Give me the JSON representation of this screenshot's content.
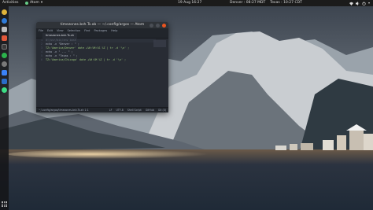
{
  "topbar": {
    "activities": "Activities",
    "app_name": "Atom",
    "clock": "19 Aug 16:27",
    "weather": [
      "Denver : 08:27 MDT",
      "Texas : 10:27 CDT"
    ],
    "tray_icons": [
      "network-icon",
      "volume-icon",
      "power-icon",
      "menu-arrow-icon"
    ]
  },
  "dock": {
    "items": [
      {
        "name": "chrome-icon",
        "color": "#e0b43a"
      },
      {
        "name": "firefox-icon",
        "color": "#2f7bd8"
      },
      {
        "name": "files-icon",
        "color": "#bcbcbc"
      },
      {
        "name": "software-icon",
        "color": "#e0583a"
      },
      {
        "name": "terminal-icon",
        "color": "#3a3a3a"
      },
      {
        "name": "spotify-icon",
        "color": "#2bb24c"
      },
      {
        "name": "settings-icon",
        "color": "#7a7a7a"
      },
      {
        "name": "chat-icon",
        "color": "#3b82f6"
      },
      {
        "name": "vscode-icon",
        "color": "#2a6cc8"
      },
      {
        "name": "android-icon",
        "color": "#3ddc84"
      }
    ]
  },
  "window": {
    "title": "timezones.bsh.Ts.ob — ~/.config/argos — Atom",
    "menu": [
      "File",
      "Edit",
      "View",
      "Selection",
      "Find",
      "Packages",
      "Help"
    ],
    "tab": "timezones.bsh.Ts.sh",
    "line_numbers": [
      "1",
      "2",
      "3",
      "4",
      "5",
      "6"
    ],
    "code": [
      "#!/usr/bin/env bash",
      "echo -n \"Denver : \" ;",
      "TZ='America/Denver' date +%H:%M:%S %Z | tr -d '\\n' ;",
      "echo -n \" ... \" ;",
      "echo -n \"Texas : \" ;",
      "TZ='America/Chicago' date +%H:%M %Z | tr -d '\\n' ;"
    ],
    "status_left": "~/.config/argos/timezones.bsh.Ts.sh  1:1",
    "status_right": [
      "LF",
      "UTF-8",
      "Shell Script",
      "GitHub",
      "Git (0)"
    ]
  }
}
